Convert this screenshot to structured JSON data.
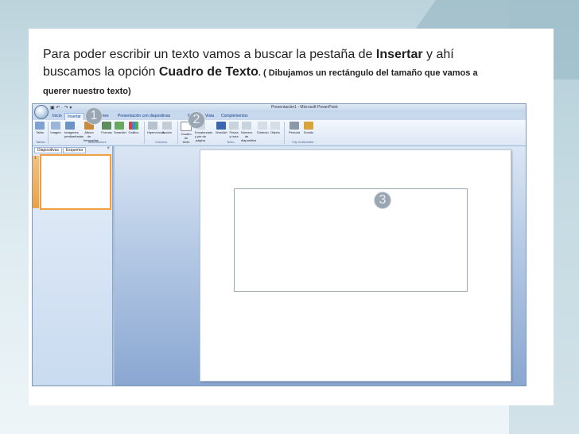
{
  "caption": {
    "line1_part1": "Para poder escribir un texto vamos a buscar la pestaña de ",
    "line1_bold": "Insertar",
    "line1_part2": " y ahí",
    "line2_part1": "buscamos la opción ",
    "line2_bold": "Cuadro de Texto",
    "line2_part2": ". ( Dibujamos un rectángulo del tamaño que vamos a",
    "line3": "querer nuestro texto)"
  },
  "window": {
    "title": "Presentación1 - Microsoft PowerPoint",
    "qat": "▣ ↶ · ↷ ▾"
  },
  "tabs": [
    "Inicio",
    "Insertar",
    "Animaciones",
    "Presentación con diapositivas",
    "Revisar",
    "Vista",
    "Complementos"
  ],
  "ribbon": {
    "buttons": [
      "Tabla",
      "Imagen",
      "Imágenes prediseñadas",
      "Álbum de fotografías",
      "Formas",
      "SmartArt",
      "Gráfico",
      "Hipervínculo",
      "Acción",
      "Cuadro de texto",
      "Encabezado y pie de página",
      "WordArt",
      "Fecha y hora",
      "Número de diapositiva",
      "Símbolo",
      "Objeto",
      "Película",
      "Sonido"
    ],
    "groups": [
      "Tablas",
      "Ilustraciones",
      "Vínculos",
      "Texto",
      "Clip multimedia"
    ]
  },
  "left_pane": {
    "tab_slides": "Diapositivas",
    "tab_outline": "Esquema",
    "close": "×",
    "slide_number": "1"
  },
  "badges": [
    "1",
    "2",
    "3"
  ],
  "colors": {
    "badge": "#9aa6b1",
    "thumbnail_border": "#f0a040",
    "ribbon_text": "#15428b"
  }
}
